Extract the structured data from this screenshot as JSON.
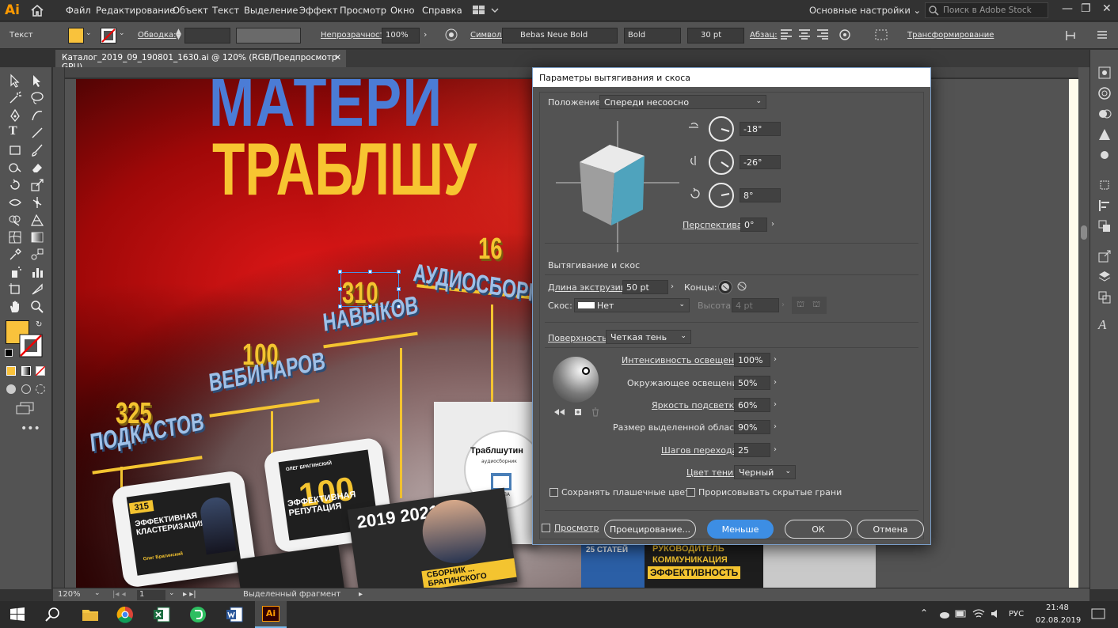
{
  "app": {
    "logo": "Ai",
    "accent": "#ff9a00"
  },
  "menu": [
    "Файл",
    "Редактирование",
    "Объект",
    "Текст",
    "Выделение",
    "Эффект",
    "Просмотр",
    "Окно",
    "Справка"
  ],
  "workspace": "Основные настройки",
  "stock_search_placeholder": "Поиск в Adobe Stock",
  "control": {
    "object_type": "Текст",
    "stroke_label": "Обводка:",
    "opacity_label": "Непрозрачность:",
    "opacity_value": "100%",
    "char_label": "Символ:",
    "font_name": "Bebas Neue Bold",
    "font_style": "Bold",
    "font_size": "30 pt",
    "para_label": "Абзац:",
    "transform_label": "Трансформирование",
    "fill_color": "#f9c23c"
  },
  "doc_tab": "Каталог_2019_09_190801_1630.ai @ 120% (RGB/Предпросмотр GPU)",
  "artwork": {
    "title_line1": "МАТЕРИ",
    "title_line2": "ТРАБЛШУ",
    "stats": [
      {
        "num": "16",
        "label": "АУДИОСБОРН"
      },
      {
        "num": "310",
        "label": "НАВЫКОВ"
      },
      {
        "num": "100",
        "label": "ВЕБИНАРОВ"
      },
      {
        "num": "325",
        "label": "ПОДКАСТОВ"
      }
    ],
    "tablet1": {
      "badge": "315",
      "title": "ЭФФЕКТИВНАЯ КЛАСТЕРИЗАЦИЯ",
      "author": "Олег Брагинский"
    },
    "tablet2": {
      "author": "ОЛЕГ БРАГИНСКИЙ",
      "num": "100",
      "title": "ЭФФЕКТИВНАЯ РЕПУТАЦИЯ"
    },
    "book_years": "2019 2021",
    "book_caption": "СБОРНИК ... БРАГИНСКОГО",
    "audio_card": {
      "title": "Траблшутин",
      "subtitle": "аудиосборник",
      "logo": "ШКОЛА"
    },
    "right_books": [
      "25 СТАТЕЙ",
      "РУКОВОДИТЕЛЬ",
      "КОММУНИКАЦИЯ",
      "ЭФФЕКТИВНОСТЬ"
    ]
  },
  "dialog": {
    "title": "Параметры вытягивания и скоса",
    "position_label": "Положение:",
    "position_value": "Спереди несоосно",
    "rot_x": "-18°",
    "rot_y": "-26°",
    "rot_z": "8°",
    "perspective_label": "Перспектива:",
    "perspective_value": "0°",
    "extrude_section": "Вытягивание и скос",
    "extrude_depth_label": "Длина экструзии:",
    "extrude_depth_value": "50 pt",
    "cap_label": "Концы:",
    "bevel_label": "Скос:",
    "bevel_value": "Нет",
    "height_label": "Высота:",
    "height_value": "4 pt",
    "surface_label": "Поверхность:",
    "surface_value": "Четкая тень",
    "light_intensity_label": "Интенсивность освещения:",
    "light_intensity_value": "100%",
    "ambient_label": "Окружающее освещение:",
    "ambient_value": "50%",
    "highlight_intensity_label": "Яркость подсветки:",
    "highlight_intensity_value": "60%",
    "highlight_size_label": "Размер выделенной области:",
    "highlight_size_value": "90%",
    "blend_steps_label": "Шагов перехода:",
    "blend_steps_value": "25",
    "shade_color_label": "Цвет тени:",
    "shade_color_value": "Черный",
    "preserve_spot_label": "Сохранять плашечные цвета",
    "draw_hidden_label": "Прорисовывать скрытые грани",
    "preview_label": "Просмотр",
    "map_button": "Проецирование...",
    "less_button": "Меньше",
    "ok_button": "ОК",
    "cancel_button": "Отмена",
    "cube_front_color": "#4fa3bd"
  },
  "status": {
    "zoom": "120%",
    "artboard": "1",
    "selection": "Выделенный фрагмент"
  },
  "taskbar": {
    "lang": "РУС",
    "time": "21:48",
    "date": "02.08.2019"
  }
}
